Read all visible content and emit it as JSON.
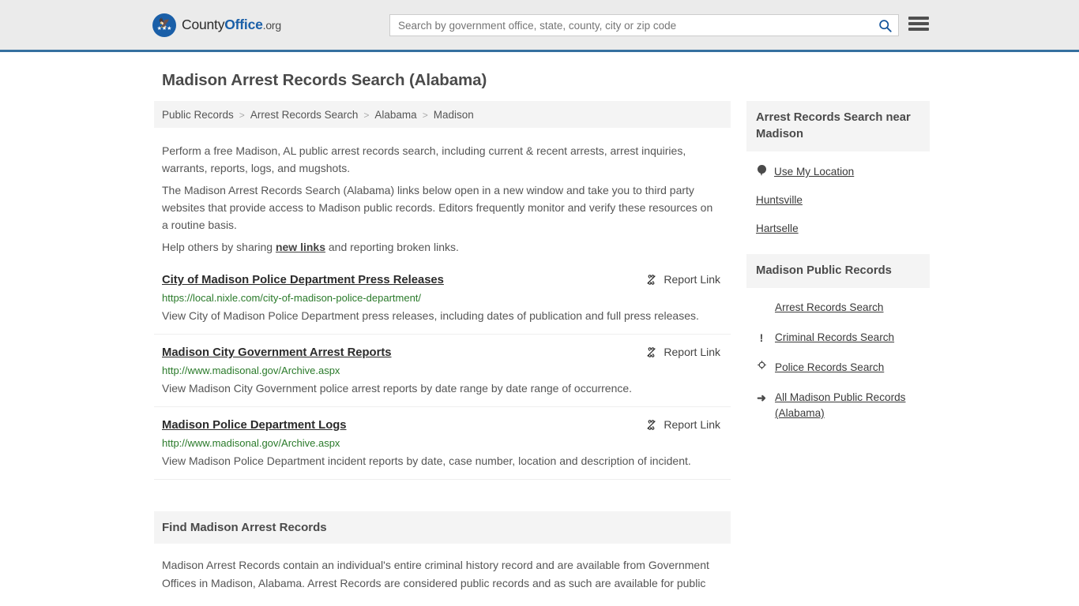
{
  "header": {
    "brand_part1": "County",
    "brand_part2": "Office",
    "brand_part3": ".org",
    "logo_icon": "eagle-seal-icon",
    "search": {
      "placeholder": "Search by government office, state, county, city or zip code",
      "value": "",
      "search_icon": "search-icon"
    },
    "menu_icon": "hamburger-menu-icon",
    "accent_color": "#35709f",
    "background_color": "#ebebeb"
  },
  "page": {
    "title": "Madison Arrest Records Search (Alabama)"
  },
  "breadcrumb": {
    "items": [
      {
        "label": "Public Records",
        "current": false
      },
      {
        "label": "Arrest Records Search",
        "current": false
      },
      {
        "label": "Alabama",
        "current": false
      },
      {
        "label": "Madison",
        "current": true
      }
    ],
    "separator": ">"
  },
  "intro": {
    "p1": "Perform a free Madison, AL public arrest records search, including current & recent arrests, arrest inquiries, warrants, reports, logs, and mugshots.",
    "p2": "The Madison Arrest Records Search (Alabama) links below open in a new window and take you to third party websites that provide access to Madison public records. Editors frequently monitor and verify these resources on a routine basis.",
    "p3_before": "Help others by sharing ",
    "p3_link": "new links",
    "p3_after": " and reporting broken links."
  },
  "results": {
    "report_label": "Report Link",
    "report_icon": "broken-link-icon",
    "items": [
      {
        "title": "City of Madison Police Department Press Releases",
        "url": "https://local.nixle.com/city-of-madison-police-department/",
        "description": "View City of Madison Police Department press releases, including dates of publication and full press releases."
      },
      {
        "title": "Madison City Government Arrest Reports",
        "url": "http://www.madisonal.gov/Archive.aspx",
        "description": "View Madison City Government police arrest reports by date range by date range of occurrence."
      },
      {
        "title": "Madison Police Department Logs",
        "url": "http://www.madisonal.gov/Archive.aspx",
        "description": "View Madison Police Department incident reports by date, case number, location and description of incident."
      }
    ]
  },
  "find_section": {
    "header": "Find Madison Arrest Records",
    "body": "Madison Arrest Records contain an individual's entire criminal history record and are available from Government Offices in Madison, Alabama. Arrest Records are considered public records and as such are available for public"
  },
  "sidebar": {
    "near_card": {
      "header": "Arrest Records Search near Madison",
      "items": [
        {
          "label": "Use My Location",
          "icon": "map-pin-icon",
          "has_icon": true
        },
        {
          "label": "Huntsville",
          "icon": "",
          "has_icon": false
        },
        {
          "label": "Hartselle",
          "icon": "",
          "has_icon": false
        }
      ]
    },
    "records_card": {
      "header": "Madison Public Records",
      "items": [
        {
          "label": "Arrest Records Search",
          "icon": "white-square-icon",
          "glyph": "",
          "active": true
        },
        {
          "label": "Criminal Records Search",
          "icon": "exclamation-icon",
          "glyph": "!",
          "active": false
        },
        {
          "label": "Police Records Search",
          "icon": "police-badge-icon",
          "glyph": "✪",
          "active": false
        },
        {
          "label": "All Madison Public Records (Alabama)",
          "icon": "arrow-right-icon",
          "glyph": "➜",
          "active": false
        }
      ]
    }
  }
}
